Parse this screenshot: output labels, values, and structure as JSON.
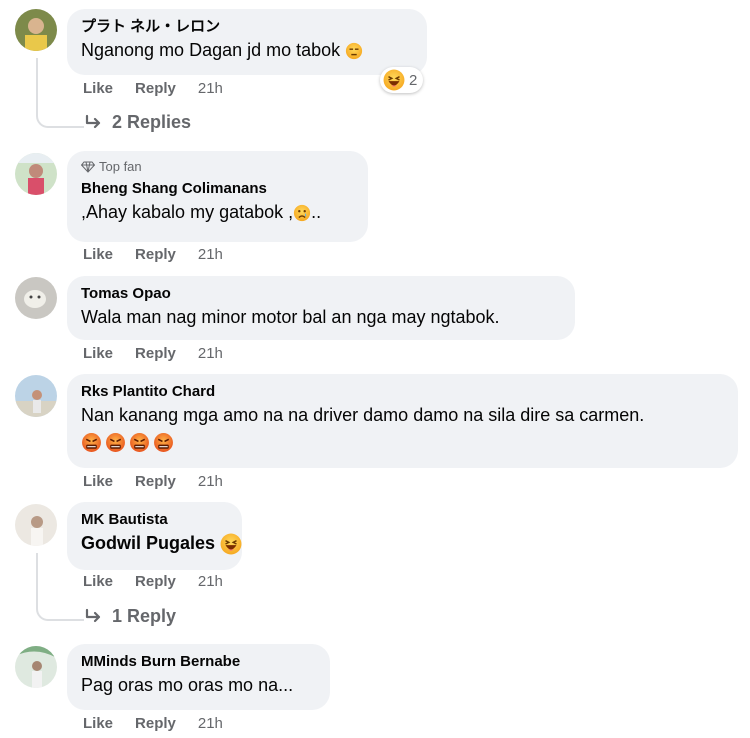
{
  "comments": [
    {
      "name": "プラト ネル・レロン",
      "text": "Nganong mo Dagan jd mo tabok ",
      "reaction_count": "2",
      "like": "Like",
      "reply": "Reply",
      "time": "21h",
      "replies": "2 Replies"
    },
    {
      "badge": "Top fan",
      "name": "Bheng Shang Colimanans",
      "text": ",Ahay kabalo my gatabok ,",
      "text_tail": "..",
      "like": "Like",
      "reply": "Reply",
      "time": "21h"
    },
    {
      "name": "Tomas Opao",
      "text": "Wala man nag minor motor bal an nga may ngtabok.",
      "like": "Like",
      "reply": "Reply",
      "time": "21h"
    },
    {
      "name": "Rks Plantito Chard",
      "text": "Nan kanang mga amo na na driver damo damo na sila dire sa carmen.",
      "like": "Like",
      "reply": "Reply",
      "time": "21h"
    },
    {
      "name": "MK Bautista",
      "text": "Godwil Pugales ",
      "like": "Like",
      "reply": "Reply",
      "time": "21h",
      "replies": "1 Reply"
    },
    {
      "name": "MMinds Burn Bernabe",
      "text": "Pag oras mo oras mo na...",
      "like": "Like",
      "reply": "Reply",
      "time": "21h"
    }
  ],
  "icons": {
    "reply_arrow": "reply-arrow-icon",
    "top_fan": "diamond-icon"
  },
  "colors": {
    "bubble": "#f0f2f5",
    "muted": "#65676b",
    "text": "#050505"
  }
}
